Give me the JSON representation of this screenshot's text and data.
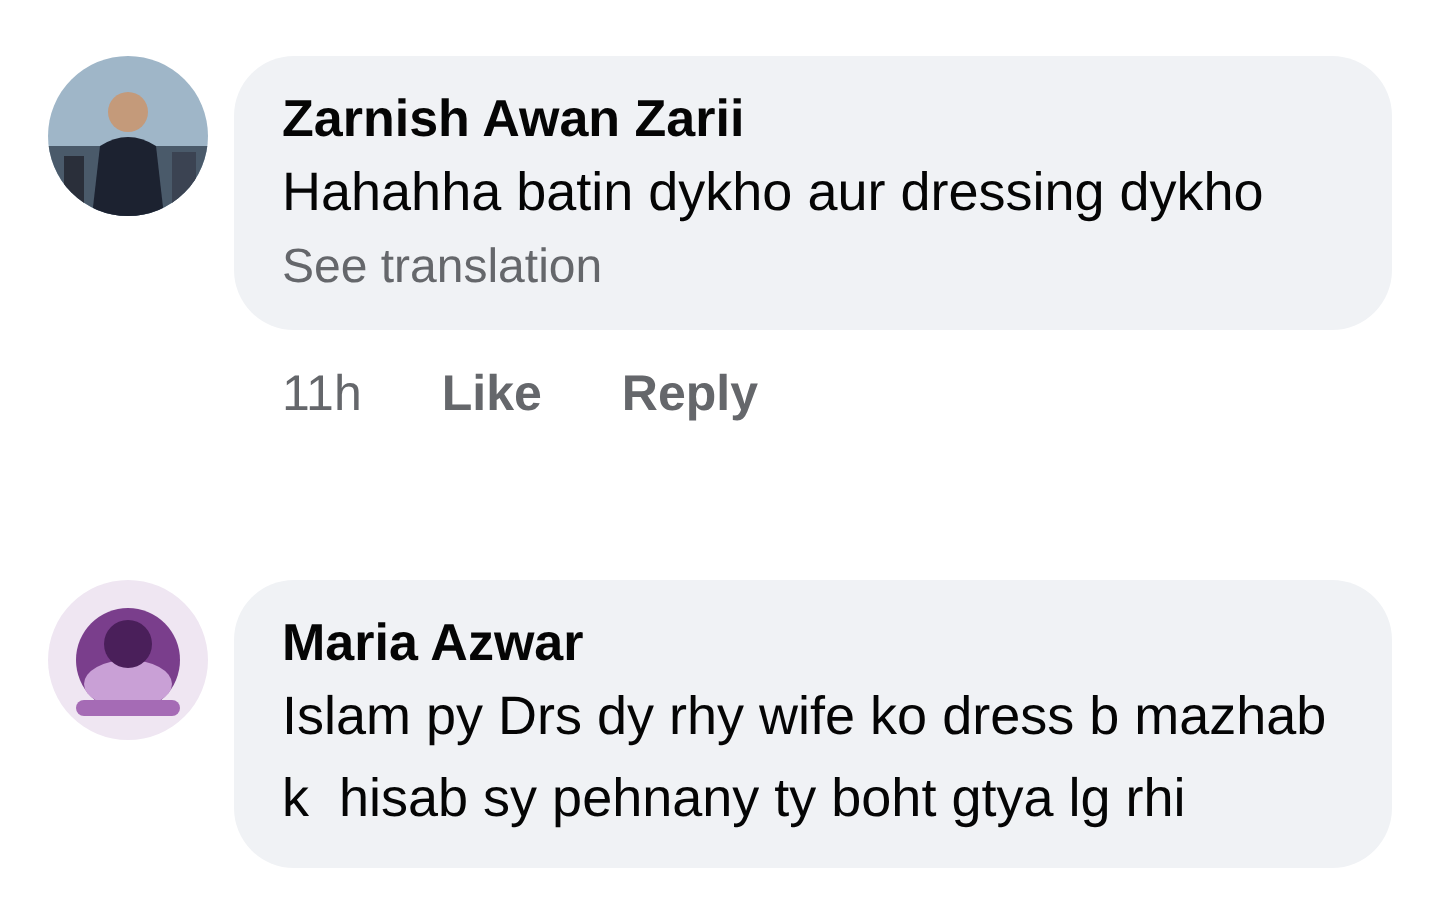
{
  "comments": [
    {
      "author": "Zarnish Awan Zarii",
      "text": "Hahahha batin dykho aur dressing dykho",
      "translation": "See translation",
      "actions": {
        "time": "11h",
        "like": "Like",
        "reply": "Reply"
      }
    },
    {
      "author": "Maria Azwar",
      "text": "Islam py Drs dy rhy wife ko dress b mazhab k  hisab sy pehnany ty boht gtya lg rhi"
    }
  ]
}
